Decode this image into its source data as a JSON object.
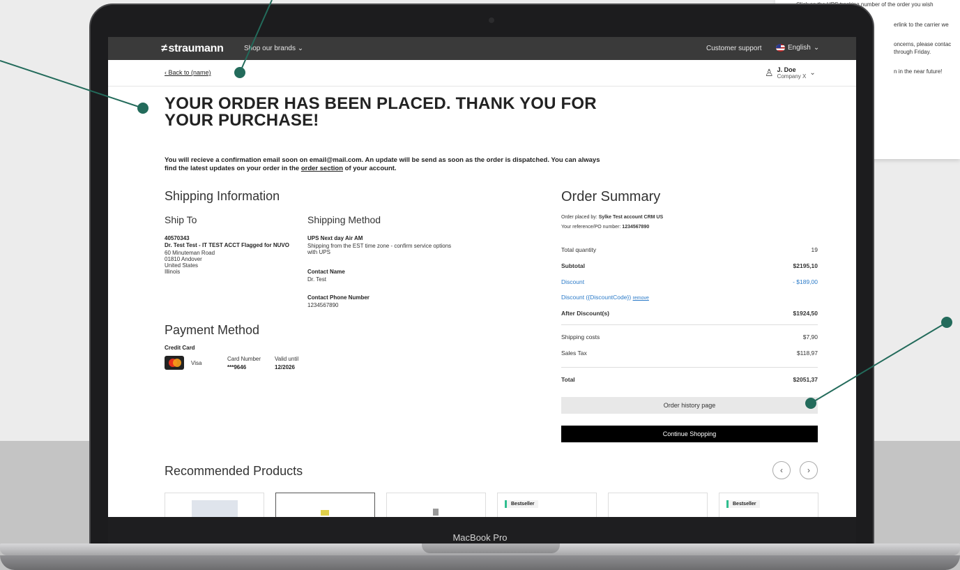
{
  "background_panel": {
    "lines": [
      "Click on the UPS tracking number of the order you wish",
      "erlink to the carrier we",
      "oncerns, please contac",
      "through Friday.",
      "n in the near future!"
    ]
  },
  "device": {
    "label": "MacBook Pro"
  },
  "topbar": {
    "logo": "straumann",
    "brands": "Shop our brands",
    "support": "Customer support",
    "language": "English"
  },
  "subbar": {
    "back": "Back to (name)",
    "user_name": "J. Doe",
    "user_company": "Company X"
  },
  "headline": "YOUR ORDER HAS BEEN PLACED. THANK YOU FOR YOUR PURCHASE!",
  "intro": {
    "part1": "You will recieve a confirmation email soon on email@mail.com. An update will be send as soon as the order is dispatched. You can always find the latest updates on your order in the ",
    "link": "order section",
    "part2": " of your account."
  },
  "shipping": {
    "title": "Shipping Information",
    "ship_to_title": "Ship To",
    "ship_to_id": "40570343",
    "ship_to_name": "Dr. Test Test - IT TEST ACCT Flagged for NUVO",
    "address_lines": [
      "60 Minuteman Road",
      "01810 Andover",
      "United States",
      "Illinois"
    ],
    "method_title": "Shipping Method",
    "method_name": "UPS Next day Air AM",
    "method_desc_1": "Shipping from the EST time zone - confirm service options",
    "method_desc_2": "with UPS",
    "contact_name_label": "Contact Name",
    "contact_name": "Dr. Test",
    "contact_phone_label": "Contact Phone Number",
    "contact_phone": "1234567890"
  },
  "payment": {
    "title": "Payment Method",
    "type": "Credit Card",
    "brand": "Visa",
    "card_number_label": "Card Number",
    "card_number": "***9646",
    "valid_label": "Valid until",
    "valid": "12/2026"
  },
  "summary": {
    "title": "Order Summary",
    "placed_by_label": "Order placed by:",
    "placed_by": "Sylke Test account CRM US",
    "reference_label": "Your reference/PO number:",
    "reference": "1234567890",
    "total_quantity_label": "Total quantity",
    "total_quantity": "19",
    "subtotal_label": "Subtotal",
    "subtotal": "$2195,10",
    "discount_label": "Discount",
    "discount": "- $189,00",
    "discount_code_label": "Discount ({DiscountCode})",
    "remove": "remove",
    "after_discount_label": "After Discount(s)",
    "after_discount": "$1924,50",
    "shipping_costs_label": "Shipping costs",
    "shipping_costs": "$7,90",
    "sales_tax_label": "Sales Tax",
    "sales_tax": "$118,97",
    "total_label": "Total",
    "total": "$2051,37",
    "order_history_button": "Order history page",
    "continue_button": "Continue Shopping"
  },
  "recommended": {
    "title": "Recommended Products",
    "badges": [
      "Bestseller",
      "Bestseller"
    ]
  },
  "colors": {
    "annotation": "#236b5b",
    "topbar": "#3a3a3a",
    "link_blue": "#2a7ac8",
    "badge_green": "#2fbe8f"
  },
  "icons": [
    "chevron-left-icon",
    "chevron-right-icon",
    "chevron-down-icon",
    "user-icon",
    "us-flag-icon",
    "mastercard-icon"
  ]
}
